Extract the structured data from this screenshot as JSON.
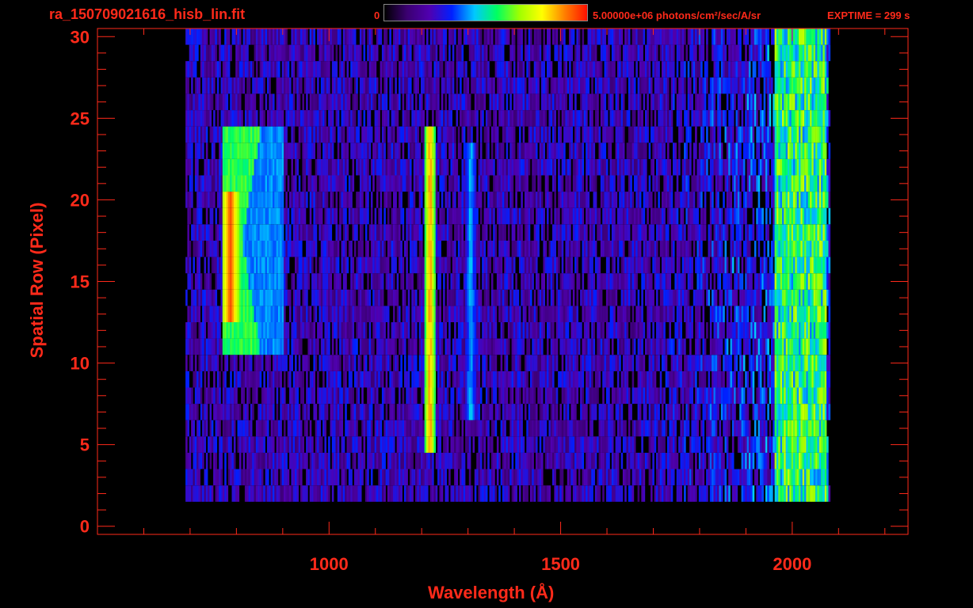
{
  "header": {
    "file_title": "ra_150709021616_hisb_lin.fit",
    "colorbar_min": "0",
    "colorbar_max": "5.00000e+06 photons/cm²/sec/A/sr",
    "exptime": "EXPTIME = 299 s"
  },
  "colors": {
    "text": "#ff2a1a",
    "axes": "#ff2a1a",
    "background": "#000000",
    "colormap": [
      "#000000",
      "#3a0070",
      "#5000b0",
      "#0020ff",
      "#00c8ff",
      "#00ff60",
      "#a0ff00",
      "#ffff00",
      "#ff8000",
      "#ff1000"
    ]
  },
  "chart_data": {
    "type": "heatmap",
    "title": "",
    "xlabel": "Wavelength (Å)",
    "ylabel": "Spatial Row (Pixel)",
    "xlim": [
      500,
      2250
    ],
    "ylim": [
      -0.5,
      30.5
    ],
    "x_ticks": [
      1000,
      1500,
      2000
    ],
    "y_ticks": [
      0,
      5,
      10,
      15,
      20,
      25,
      30
    ],
    "x_minor_step": 100,
    "y_minor_step": 1,
    "colorbar_range": [
      0,
      5000000
    ],
    "data_extent_x": [
      690,
      2080
    ],
    "data_rows": [
      2,
      30
    ],
    "features": [
      {
        "name": "Lyman-beta/O VI arc",
        "wavelength_range": [
          770,
          900
        ],
        "rows": [
          11,
          24
        ],
        "peak_wavelength": 785,
        "peak_rows": [
          13,
          20
        ],
        "level": 0.95
      },
      {
        "name": "Lyman-alpha line",
        "wavelength": 1216,
        "rows": [
          5,
          24
        ],
        "level": 0.85
      },
      {
        "name": "1304 line",
        "wavelength": 1304,
        "rows": [
          7,
          23
        ],
        "level": 0.4
      },
      {
        "name": "red edge",
        "wavelength_range": [
          1960,
          2070
        ],
        "rows": [
          2,
          30
        ],
        "level": 0.65
      }
    ]
  }
}
